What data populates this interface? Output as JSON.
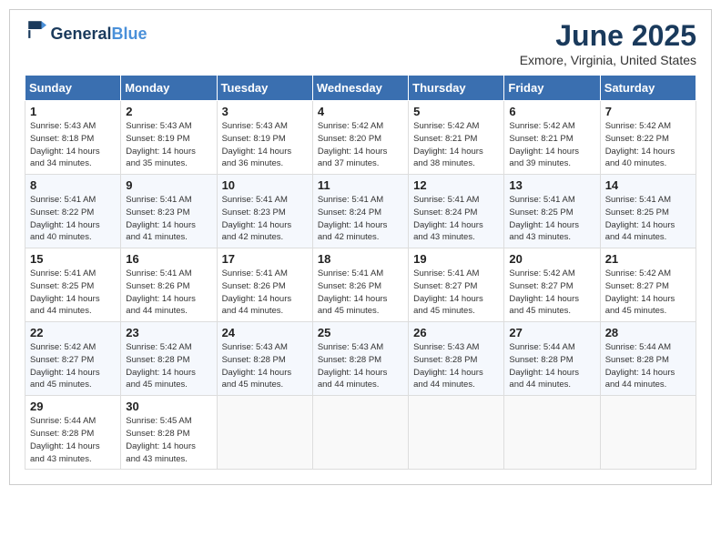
{
  "header": {
    "logo_general": "General",
    "logo_blue": "Blue",
    "title": "June 2025",
    "subtitle": "Exmore, Virginia, United States"
  },
  "columns": [
    "Sunday",
    "Monday",
    "Tuesday",
    "Wednesday",
    "Thursday",
    "Friday",
    "Saturday"
  ],
  "weeks": [
    [
      {
        "day": 1,
        "lines": [
          "Sunrise: 5:43 AM",
          "Sunset: 8:18 PM",
          "Daylight: 14 hours",
          "and 34 minutes."
        ]
      },
      {
        "day": 2,
        "lines": [
          "Sunrise: 5:43 AM",
          "Sunset: 8:19 PM",
          "Daylight: 14 hours",
          "and 35 minutes."
        ]
      },
      {
        "day": 3,
        "lines": [
          "Sunrise: 5:43 AM",
          "Sunset: 8:19 PM",
          "Daylight: 14 hours",
          "and 36 minutes."
        ]
      },
      {
        "day": 4,
        "lines": [
          "Sunrise: 5:42 AM",
          "Sunset: 8:20 PM",
          "Daylight: 14 hours",
          "and 37 minutes."
        ]
      },
      {
        "day": 5,
        "lines": [
          "Sunrise: 5:42 AM",
          "Sunset: 8:21 PM",
          "Daylight: 14 hours",
          "and 38 minutes."
        ]
      },
      {
        "day": 6,
        "lines": [
          "Sunrise: 5:42 AM",
          "Sunset: 8:21 PM",
          "Daylight: 14 hours",
          "and 39 minutes."
        ]
      },
      {
        "day": 7,
        "lines": [
          "Sunrise: 5:42 AM",
          "Sunset: 8:22 PM",
          "Daylight: 14 hours",
          "and 40 minutes."
        ]
      }
    ],
    [
      {
        "day": 8,
        "lines": [
          "Sunrise: 5:41 AM",
          "Sunset: 8:22 PM",
          "Daylight: 14 hours",
          "and 40 minutes."
        ]
      },
      {
        "day": 9,
        "lines": [
          "Sunrise: 5:41 AM",
          "Sunset: 8:23 PM",
          "Daylight: 14 hours",
          "and 41 minutes."
        ]
      },
      {
        "day": 10,
        "lines": [
          "Sunrise: 5:41 AM",
          "Sunset: 8:23 PM",
          "Daylight: 14 hours",
          "and 42 minutes."
        ]
      },
      {
        "day": 11,
        "lines": [
          "Sunrise: 5:41 AM",
          "Sunset: 8:24 PM",
          "Daylight: 14 hours",
          "and 42 minutes."
        ]
      },
      {
        "day": 12,
        "lines": [
          "Sunrise: 5:41 AM",
          "Sunset: 8:24 PM",
          "Daylight: 14 hours",
          "and 43 minutes."
        ]
      },
      {
        "day": 13,
        "lines": [
          "Sunrise: 5:41 AM",
          "Sunset: 8:25 PM",
          "Daylight: 14 hours",
          "and 43 minutes."
        ]
      },
      {
        "day": 14,
        "lines": [
          "Sunrise: 5:41 AM",
          "Sunset: 8:25 PM",
          "Daylight: 14 hours",
          "and 44 minutes."
        ]
      }
    ],
    [
      {
        "day": 15,
        "lines": [
          "Sunrise: 5:41 AM",
          "Sunset: 8:25 PM",
          "Daylight: 14 hours",
          "and 44 minutes."
        ]
      },
      {
        "day": 16,
        "lines": [
          "Sunrise: 5:41 AM",
          "Sunset: 8:26 PM",
          "Daylight: 14 hours",
          "and 44 minutes."
        ]
      },
      {
        "day": 17,
        "lines": [
          "Sunrise: 5:41 AM",
          "Sunset: 8:26 PM",
          "Daylight: 14 hours",
          "and 44 minutes."
        ]
      },
      {
        "day": 18,
        "lines": [
          "Sunrise: 5:41 AM",
          "Sunset: 8:26 PM",
          "Daylight: 14 hours",
          "and 45 minutes."
        ]
      },
      {
        "day": 19,
        "lines": [
          "Sunrise: 5:41 AM",
          "Sunset: 8:27 PM",
          "Daylight: 14 hours",
          "and 45 minutes."
        ]
      },
      {
        "day": 20,
        "lines": [
          "Sunrise: 5:42 AM",
          "Sunset: 8:27 PM",
          "Daylight: 14 hours",
          "and 45 minutes."
        ]
      },
      {
        "day": 21,
        "lines": [
          "Sunrise: 5:42 AM",
          "Sunset: 8:27 PM",
          "Daylight: 14 hours",
          "and 45 minutes."
        ]
      }
    ],
    [
      {
        "day": 22,
        "lines": [
          "Sunrise: 5:42 AM",
          "Sunset: 8:27 PM",
          "Daylight: 14 hours",
          "and 45 minutes."
        ]
      },
      {
        "day": 23,
        "lines": [
          "Sunrise: 5:42 AM",
          "Sunset: 8:28 PM",
          "Daylight: 14 hours",
          "and 45 minutes."
        ]
      },
      {
        "day": 24,
        "lines": [
          "Sunrise: 5:43 AM",
          "Sunset: 8:28 PM",
          "Daylight: 14 hours",
          "and 45 minutes."
        ]
      },
      {
        "day": 25,
        "lines": [
          "Sunrise: 5:43 AM",
          "Sunset: 8:28 PM",
          "Daylight: 14 hours",
          "and 44 minutes."
        ]
      },
      {
        "day": 26,
        "lines": [
          "Sunrise: 5:43 AM",
          "Sunset: 8:28 PM",
          "Daylight: 14 hours",
          "and 44 minutes."
        ]
      },
      {
        "day": 27,
        "lines": [
          "Sunrise: 5:44 AM",
          "Sunset: 8:28 PM",
          "Daylight: 14 hours",
          "and 44 minutes."
        ]
      },
      {
        "day": 28,
        "lines": [
          "Sunrise: 5:44 AM",
          "Sunset: 8:28 PM",
          "Daylight: 14 hours",
          "and 44 minutes."
        ]
      }
    ],
    [
      {
        "day": 29,
        "lines": [
          "Sunrise: 5:44 AM",
          "Sunset: 8:28 PM",
          "Daylight: 14 hours",
          "and 43 minutes."
        ]
      },
      {
        "day": 30,
        "lines": [
          "Sunrise: 5:45 AM",
          "Sunset: 8:28 PM",
          "Daylight: 14 hours",
          "and 43 minutes."
        ]
      },
      null,
      null,
      null,
      null,
      null
    ]
  ]
}
